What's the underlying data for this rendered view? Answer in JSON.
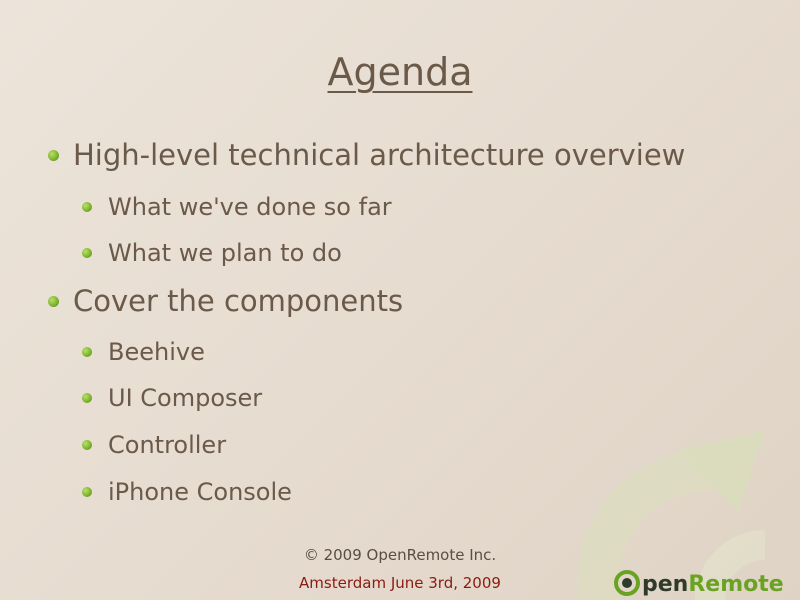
{
  "slide": {
    "title": "Agenda",
    "bullets": [
      {
        "level": 1,
        "text": "High-level technical architecture overview"
      },
      {
        "level": 2,
        "text": "What we've done so far"
      },
      {
        "level": 2,
        "text": "What we plan to do"
      },
      {
        "level": 1,
        "text": "Cover the components"
      },
      {
        "level": 2,
        "text": "Beehive"
      },
      {
        "level": 2,
        "text": "UI Composer"
      },
      {
        "level": 2,
        "text": "Controller"
      },
      {
        "level": 2,
        "text": "iPhone Console"
      }
    ],
    "footer": {
      "copyright": "© 2009 OpenRemote Inc.",
      "event": "Amsterdam June 3rd, 2009"
    },
    "logo": {
      "prefix": "pen",
      "suffix": "Remote"
    }
  },
  "colors": {
    "background": "#e8ded3",
    "text": "#6b5a4a",
    "bullet": "#7fb52d",
    "event_text": "#8a1b12",
    "logo_dark": "#2f3a2a",
    "logo_green": "#6aa323"
  }
}
